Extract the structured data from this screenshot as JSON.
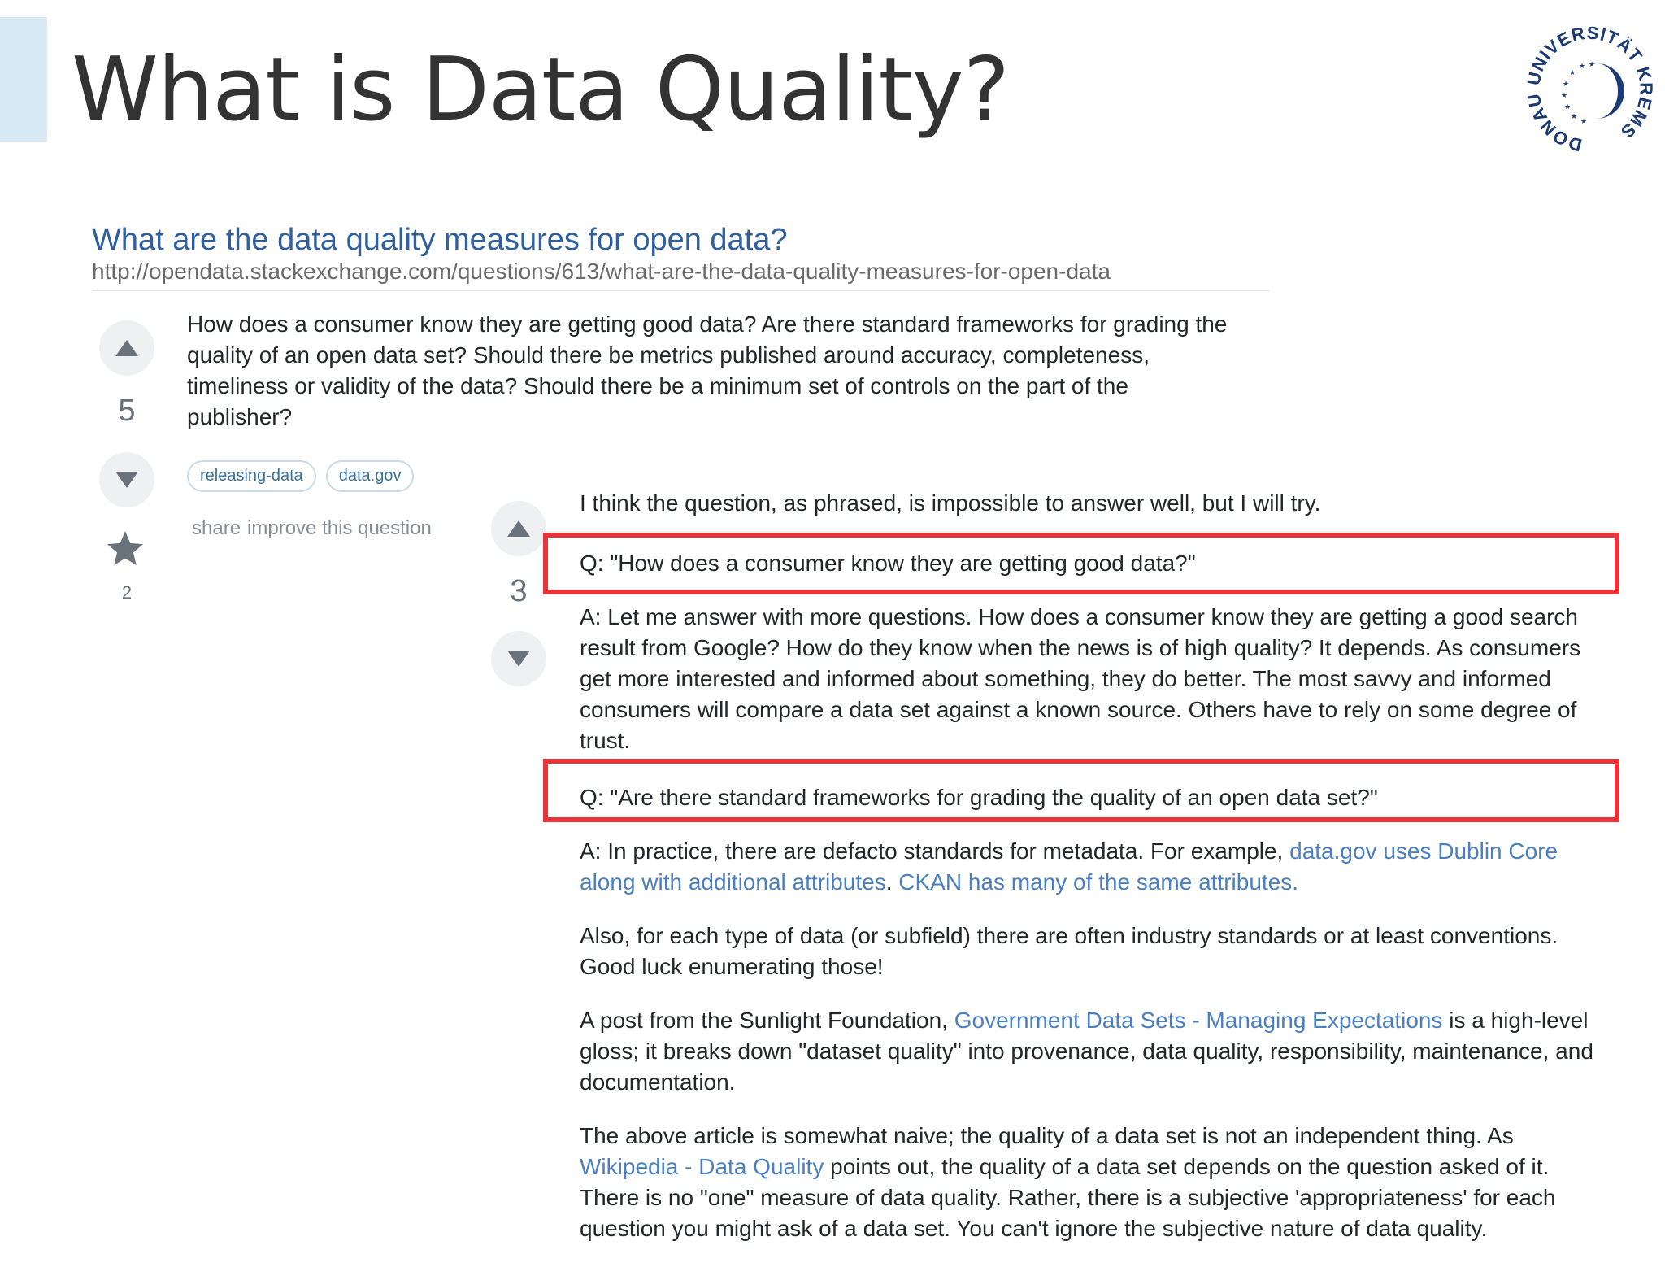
{
  "slide": {
    "title": "What is Data Quality?",
    "logo_text": "DONAU UNIVERSITÄT KREMS"
  },
  "question": {
    "title": "What are the data quality measures for open data?",
    "url": "http://opendata.stackexchange.com/questions/613/what-are-the-data-quality-measures-for-open-data",
    "votes": "5",
    "body": "How does a consumer know they are getting good data? Are there standard frameworks for grading the quality of an open data set? Should there be metrics published around accuracy, completeness, timeliness or validity of the data? Should there be a minimum set of controls on the part of the publisher?",
    "tags": [
      "releasing-data",
      "data.gov"
    ],
    "share_label": "share",
    "improve_label": "improve this question",
    "favorite_count": "2"
  },
  "answer": {
    "votes": "3",
    "intro": "I think the question, as phrased, is impossible to answer well, but I will try.",
    "q1": "Q: \"How does a consumer know they are getting good data?\"",
    "a1": "A: Let me answer with more questions. How does a consumer know they are getting a good search result from Google? How do they know when the news is of high quality? It depends. As consumers get more interested and informed about something, they do better. The most savvy and informed consumers will compare a data set against a known source. Others have to rely on some degree of trust.",
    "q2": "Q: \"Are there standard frameworks for grading the quality of an open data set?\"",
    "a2_prefix": "A: In practice, there are defacto standards for metadata. For example, ",
    "a2_link1": "data.gov uses Dublin Core along with additional attributes",
    "a2_mid": ". ",
    "a2_link2": "CKAN has many of the same attributes.",
    "p3": "Also, for each type of data (or subfield) there are often industry standards or at least conventions. Good luck enumerating those!",
    "p4_prefix": "A post from the Sunlight Foundation, ",
    "p4_link": "Government Data Sets - Managing Expectations",
    "p4_suffix": " is a high-level gloss; it breaks down \"dataset quality\" into provenance, data quality, responsibility, maintenance, and documentation.",
    "p5_prefix": "The above article is somewhat naive; the quality of a data set is not an independent thing. As ",
    "p5_link": "Wikipedia - Data Quality",
    "p5_suffix": " points out, the quality of a data set depends on the question asked of it. There is no \"one\" measure of data quality. Rather, there is a subjective 'appropriateness' for each question you might ask of a data set. You can't ignore the subjective nature of data quality."
  },
  "colors": {
    "title_link": "#2f5f9e",
    "link": "#4a7fc1",
    "highlight": "#e8343a",
    "logo": "#1c3a73",
    "accent_bar": "#d6e9f5"
  }
}
